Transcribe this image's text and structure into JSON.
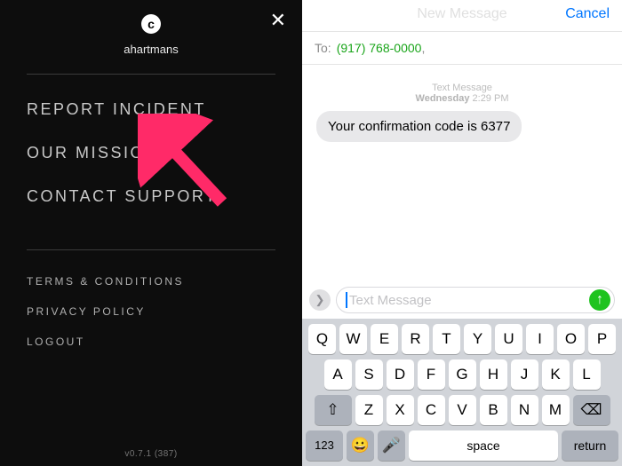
{
  "left": {
    "close_icon": "✕",
    "logo_letter": "c",
    "username": "ahartmans",
    "menu_main": [
      "REPORT INCIDENT",
      "OUR MISSION",
      "CONTACT SUPPORT"
    ],
    "menu_sec": [
      "TERMS & CONDITIONS",
      "PRIVACY POLICY",
      "LOGOUT"
    ],
    "version": "v0.7.1 (387)"
  },
  "right": {
    "nav_title": "New Message",
    "nav_cancel": "Cancel",
    "to_label": "To:",
    "to_number": "(917) 768-0000",
    "to_comma": ",",
    "stamp_line1": "Text Message",
    "stamp_day": "Wednesday",
    "stamp_time": "2:29 PM",
    "bubble_text": "Your confirmation code is 6377",
    "input_placeholder": "Text Message",
    "chevron_glyph": "❯",
    "send_glyph": "↑",
    "kb": {
      "row1": [
        "Q",
        "W",
        "E",
        "R",
        "T",
        "Y",
        "U",
        "I",
        "O",
        "P"
      ],
      "row2": [
        "A",
        "S",
        "D",
        "F",
        "G",
        "H",
        "J",
        "K",
        "L"
      ],
      "row3_mid": [
        "Z",
        "X",
        "C",
        "V",
        "B",
        "N",
        "M"
      ],
      "shift_glyph": "⇧",
      "bksp_glyph": "⌫",
      "num_label": "123",
      "emoji_glyph": "😀",
      "mic_glyph": "🎤",
      "space_label": "space",
      "return_label": "return"
    }
  }
}
